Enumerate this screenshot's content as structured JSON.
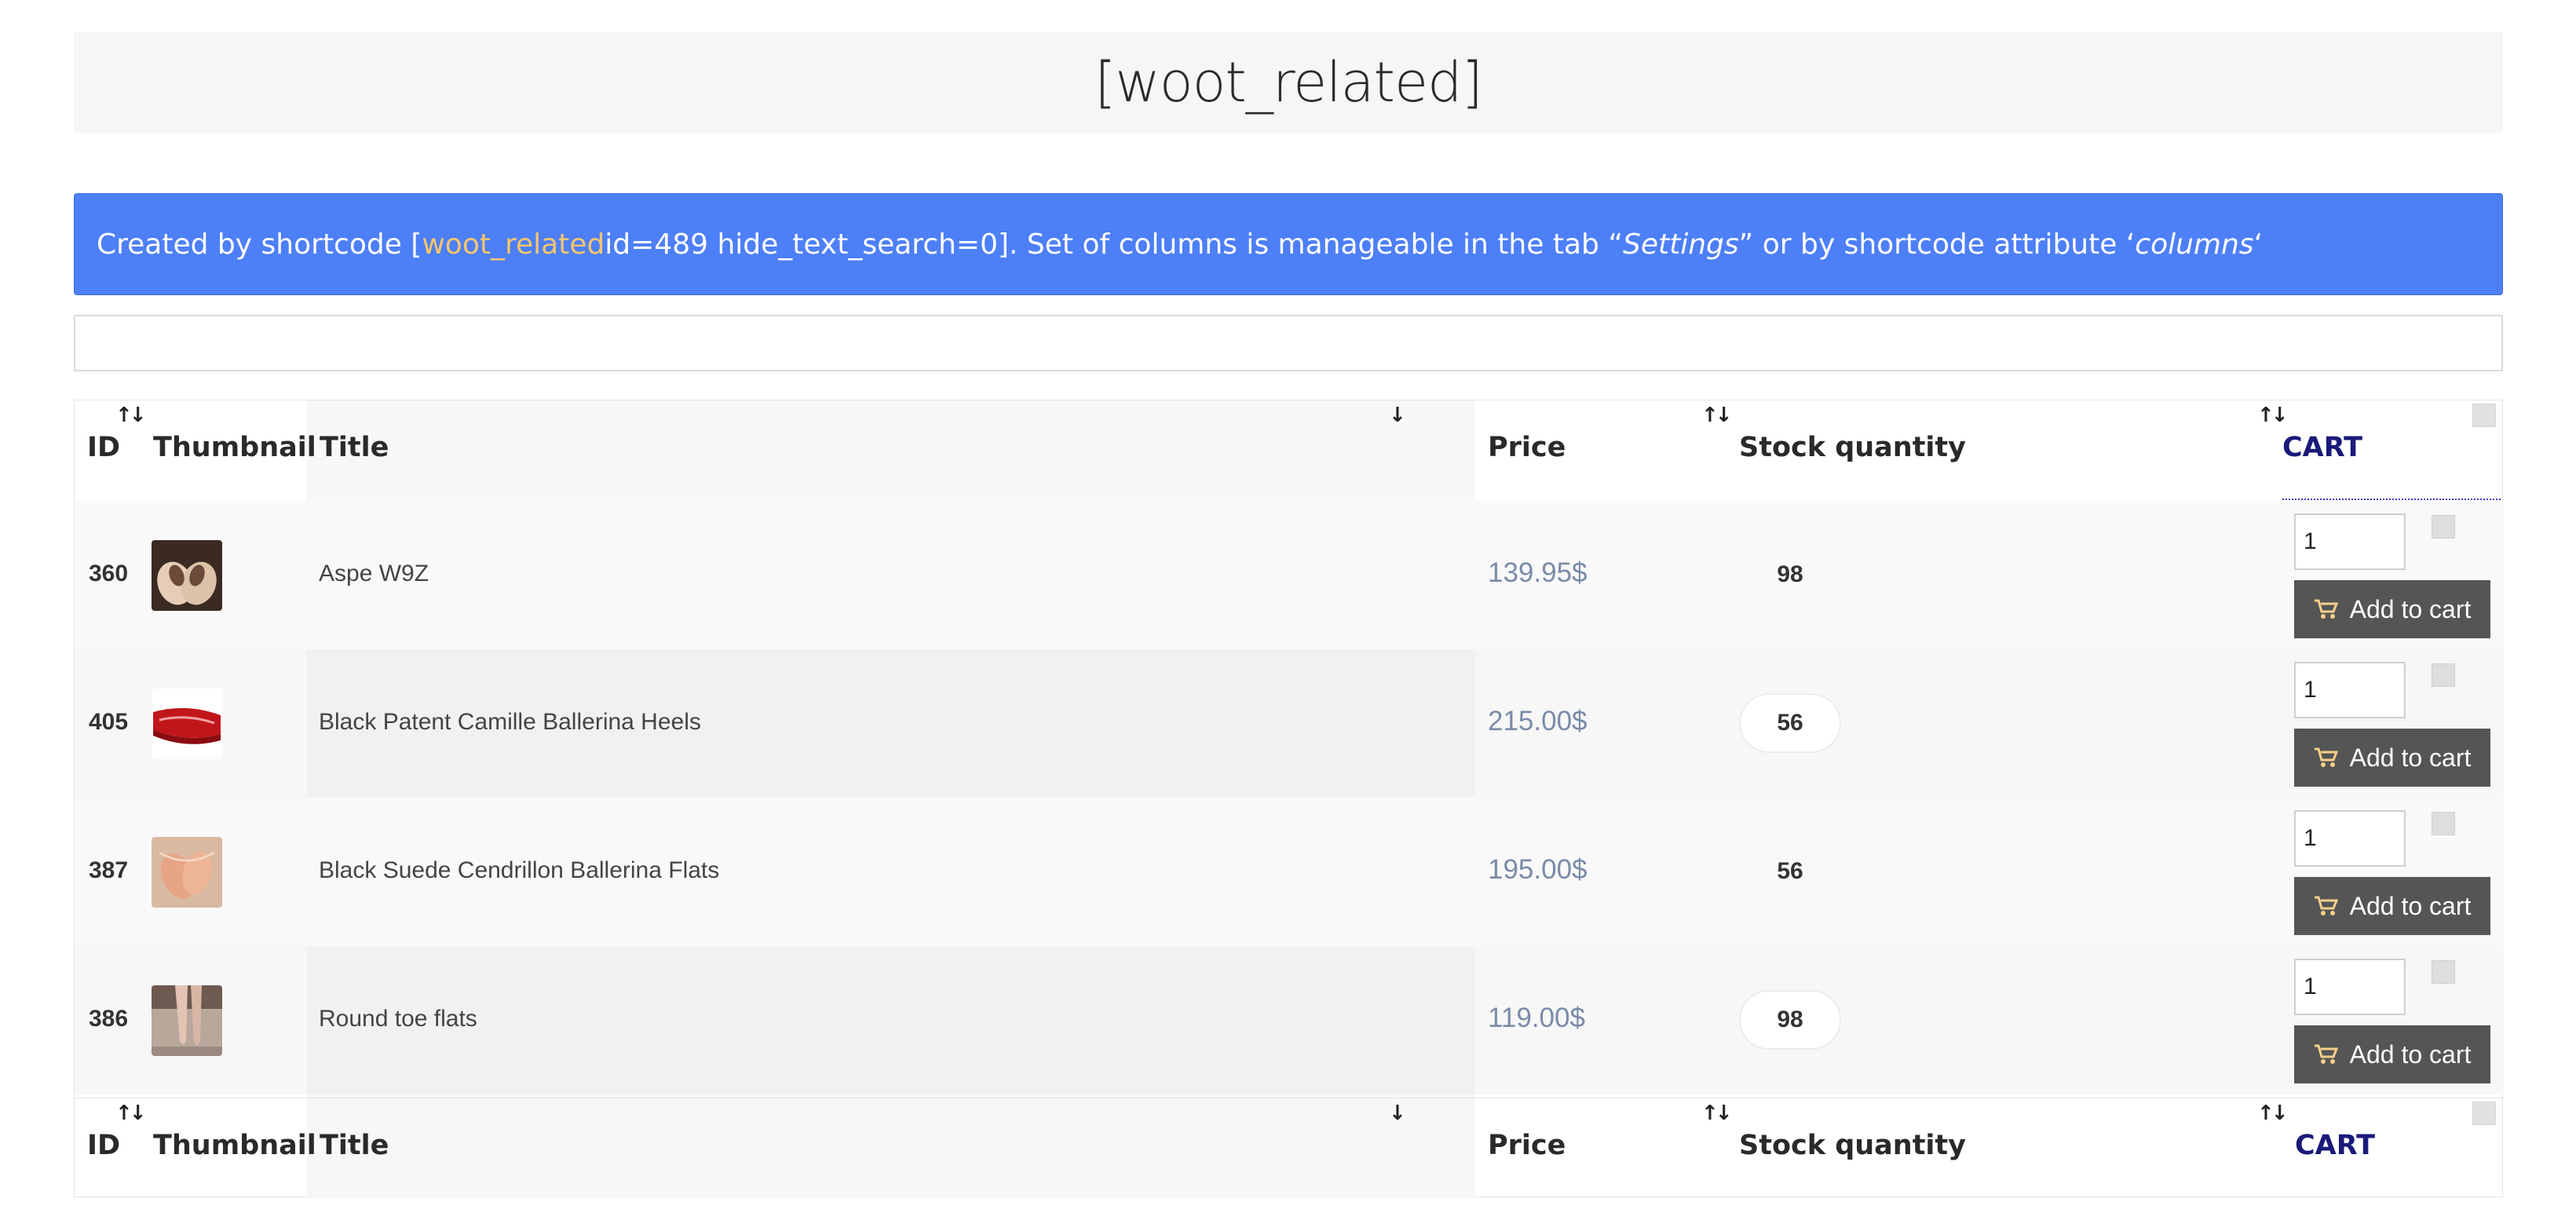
{
  "page": {
    "title": "[woot_related]"
  },
  "notice": {
    "prefix": "Created by shortcode [",
    "shortcode": "woot_related",
    "middle": " id=489 hide_text_search=0]. Set of columns is manageable in the tab “",
    "tab_name": "Settings",
    "suffix": "” or by shortcode attribute ‘",
    "attribute": "columns",
    "end": "‘"
  },
  "search": {
    "value": ""
  },
  "table": {
    "columns": {
      "id": "ID",
      "thumbnail": "Thumbnail",
      "title": "Title",
      "price": "Price",
      "stock": "Stock quantity",
      "cart": "CART"
    },
    "sort_icons": {
      "both": "↑↓",
      "down": "↓"
    },
    "add_to_cart_label": "Add to cart",
    "rows": [
      {
        "id": "360",
        "title": "Aspe W9Z",
        "price": "139.95$",
        "stock": "98",
        "qty": "1",
        "thumb_icon": "beige-shoes-thumbnail"
      },
      {
        "id": "405",
        "title": "Black Patent Camille Ballerina Heels",
        "price": "215.00$",
        "stock": "56",
        "qty": "1",
        "thumb_icon": "red-heels-thumbnail"
      },
      {
        "id": "387",
        "title": "Black Suede Cendrillon Ballerina Flats",
        "price": "195.00$",
        "stock": "56",
        "qty": "1",
        "thumb_icon": "pink-flats-thumbnail"
      },
      {
        "id": "386",
        "title": "Round toe flats",
        "price": "119.00$",
        "stock": "98",
        "qty": "1",
        "thumb_icon": "pointe-shoes-thumbnail"
      }
    ]
  },
  "colors": {
    "notice_bg": "#4d7ff7",
    "notice_highlight": "#f6c66c",
    "price": "#7a8ba8",
    "cart_header": "#1a1a7a",
    "button_bg": "#555555"
  }
}
